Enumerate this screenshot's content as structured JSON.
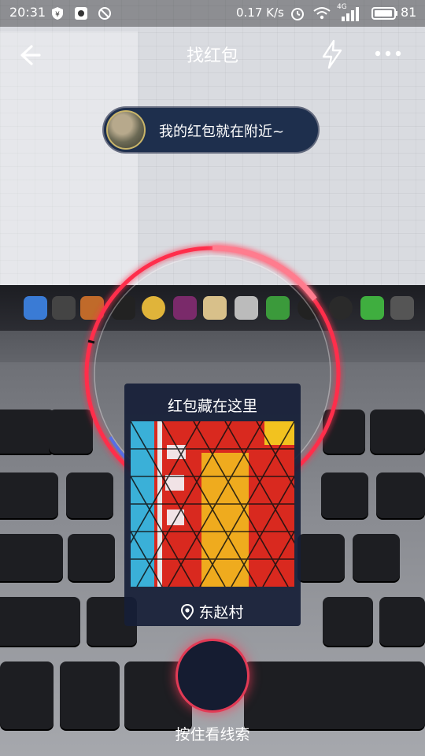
{
  "status_bar": {
    "time": "20:31",
    "speed": "0.17 K/s",
    "network": "4G",
    "battery": "81"
  },
  "header": {
    "title": "找红包"
  },
  "hint_bubble": {
    "text": "我的红包就在附近~"
  },
  "clue_card": {
    "title": "红包藏在这里",
    "location": "东赵村"
  },
  "hold_button": {
    "label": "按住看线索"
  },
  "colors": {
    "accent_red": "#e23a55",
    "card_bg": "#161e37",
    "bubble_bg": "#1e2f4d"
  },
  "icons": [
    "back-arrow",
    "flash",
    "more-dots",
    "location-pin"
  ]
}
